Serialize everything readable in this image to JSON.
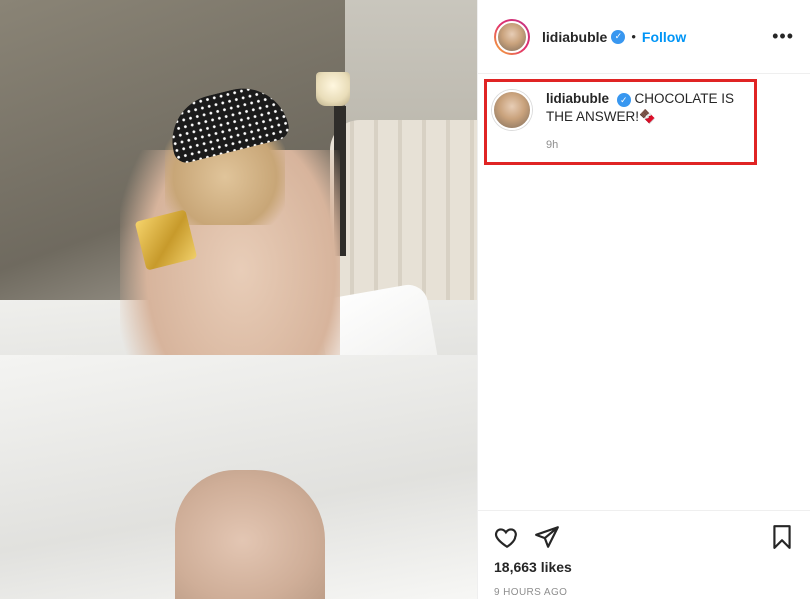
{
  "post": {
    "username": "lidiabuble",
    "separator": "•",
    "follow_label": "Follow",
    "more_label": "•••"
  },
  "caption": {
    "username": "lidiabuble",
    "text": "CHOCOLATE IS THE ANSWER!🍫",
    "time": "9h"
  },
  "stats": {
    "likes": "18,663 likes",
    "posted": "9 HOURS AGO"
  },
  "icons": {
    "verified": "verified-badge-icon",
    "like": "heart-icon",
    "share": "paper-plane-icon",
    "save": "bookmark-icon",
    "more": "more-options-icon"
  },
  "colors": {
    "accent": "#0095f6",
    "verified": "#3897f0",
    "highlight_box": "#e02424",
    "muted": "#8e8e8e",
    "text": "#262626"
  }
}
